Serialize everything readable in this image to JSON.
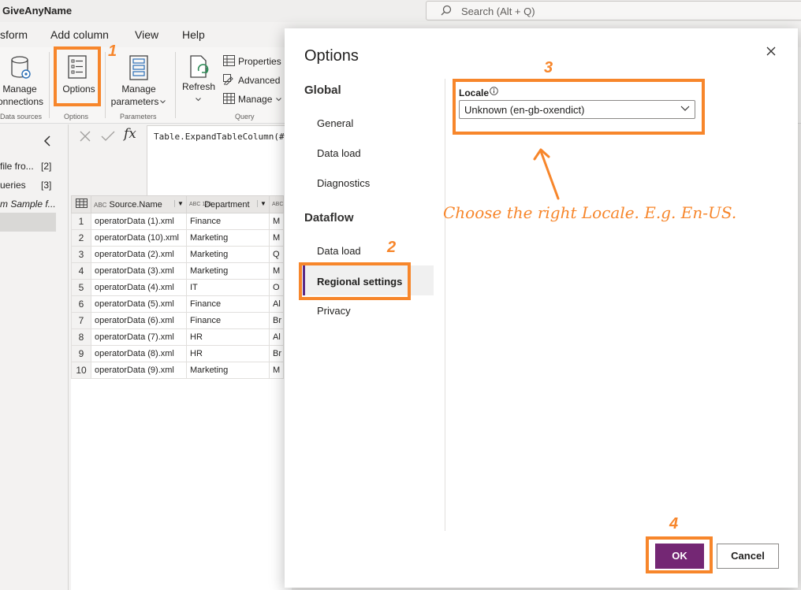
{
  "app": {
    "title": "GiveAnyName",
    "search_placeholder": "Search (Alt + Q)"
  },
  "menu": [
    "sform",
    "Add column",
    "View",
    "Help"
  ],
  "ribbon": {
    "manage_connections": [
      "Manage",
      "onnections"
    ],
    "options": "Options",
    "manage_parameters": [
      "Manage",
      "parameters"
    ],
    "refresh": "Refresh",
    "properties": "Properties",
    "advanced": "Advanced",
    "manage": "Manage",
    "groups": [
      "Data sources",
      "Options",
      "Parameters",
      "Query"
    ]
  },
  "queries": [
    {
      "name": "file fro...",
      "count": "[2]"
    },
    {
      "name": "ueries",
      "count": "[3]"
    },
    {
      "name": "m Sample f...",
      "count": ""
    }
  ],
  "formula": "Table.ExpandTableColumn(#",
  "grid": {
    "columns": [
      {
        "type": "ABC",
        "name": "Source.Name"
      },
      {
        "type": "ABC 123",
        "name": "Department"
      },
      {
        "type": "ABC 123",
        "name": ""
      }
    ],
    "rows": [
      [
        "1",
        "operatorData (1).xml",
        "Finance",
        "M"
      ],
      [
        "2",
        "operatorData (10).xml",
        "Marketing",
        "M"
      ],
      [
        "3",
        "operatorData (2).xml",
        "Marketing",
        "Q"
      ],
      [
        "4",
        "operatorData (3).xml",
        "Marketing",
        "M"
      ],
      [
        "5",
        "operatorData (4).xml",
        "IT",
        "O"
      ],
      [
        "6",
        "operatorData (5).xml",
        "Finance",
        "Al"
      ],
      [
        "7",
        "operatorData (6).xml",
        "Finance",
        "Br"
      ],
      [
        "8",
        "operatorData (7).xml",
        "HR",
        "Al"
      ],
      [
        "9",
        "operatorData (8).xml",
        "HR",
        "Br"
      ],
      [
        "10",
        "operatorData (9).xml",
        "Marketing",
        "M"
      ]
    ]
  },
  "dialog": {
    "title": "Options",
    "global_label": "Global",
    "global_items": [
      "General",
      "Data load",
      "Diagnostics"
    ],
    "dataflow_label": "Dataflow",
    "dataflow_items": [
      "Data load",
      "Regional settings",
      "Privacy"
    ],
    "locale_label": "Locale",
    "locale_value": "Unknown (en-gb-oxendict)",
    "ok_label": "OK",
    "cancel_label": "Cancel"
  },
  "annotations": {
    "step1": "1",
    "step2": "2",
    "step3": "3",
    "step4": "4",
    "note": "Choose the right Locale. E.g. En-US."
  },
  "colors": {
    "accent": "#742774",
    "highlight": "#f7862b"
  }
}
